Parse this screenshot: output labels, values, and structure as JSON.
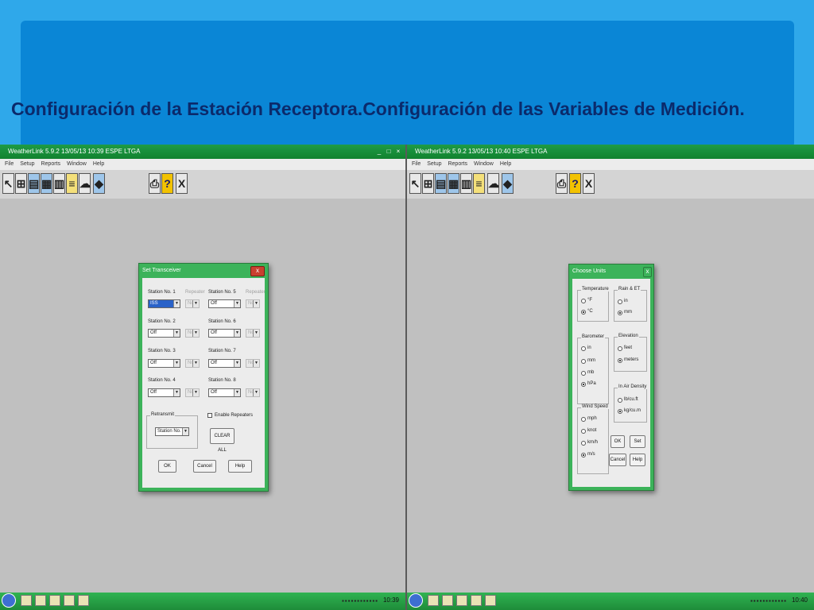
{
  "slide": {
    "title": "Configuración de la Estación Receptora.Configuración de las Variables de Medición."
  },
  "windows": {
    "left": {
      "title": "WeatherLink 5.9.2  13/05/13  10:39  ESPE LTGA",
      "clock": "10:39",
      "menu": [
        "File",
        "Setup",
        "Reports",
        "Window",
        "Help"
      ]
    },
    "right": {
      "title": "WeatherLink 5.9.2  13/05/13  10:40  ESPE LTGA",
      "clock": "10:40",
      "menu": [
        "File",
        "Setup",
        "Reports",
        "Window",
        "Help"
      ]
    }
  },
  "toolbar": {
    "quit_label": "X",
    "help_label": "?"
  },
  "set_transceiver": {
    "title": "Set Transceiver",
    "close": "x",
    "repeater_label": "Repeater",
    "stations": [
      {
        "label": "Station No. 1",
        "value": "ISS",
        "repeater": "No"
      },
      {
        "label": "Station No. 2",
        "value": "Off",
        "repeater": "No"
      },
      {
        "label": "Station No. 3",
        "value": "Off",
        "repeater": "No"
      },
      {
        "label": "Station No. 4",
        "value": "Off",
        "repeater": "No"
      },
      {
        "label": "Station No. 5",
        "value": "Off",
        "repeater": "No"
      },
      {
        "label": "Station No. 6",
        "value": "Off",
        "repeater": "No"
      },
      {
        "label": "Station No. 7",
        "value": "Off",
        "repeater": "No"
      },
      {
        "label": "Station No. 8",
        "value": "Off",
        "repeater": "No"
      }
    ],
    "retransmit_label": "Retransmit",
    "retransmit_value": "Station No. 2",
    "enable_repeaters": "Enable Repeaters",
    "clear_all": "CLEAR ALL",
    "ok": "OK",
    "cancel": "Cancel",
    "help": "Help"
  },
  "choose_units": {
    "title": "Choose Units",
    "close": "x",
    "temperature": {
      "label": "Temperature",
      "options": [
        "°F",
        "°C"
      ],
      "selected": "°C"
    },
    "barometer": {
      "label": "Barometer",
      "options": [
        "in",
        "mm",
        "mb",
        "hPa"
      ],
      "selected": "hPa"
    },
    "wind_speed": {
      "label": "Wind Speed",
      "options": [
        "mph",
        "knot",
        "km/h",
        "m/s"
      ],
      "selected": "m/s"
    },
    "rain_et": {
      "label": "Rain & ET",
      "options": [
        "in",
        "mm"
      ],
      "selected": "mm"
    },
    "elevation": {
      "label": "Elevation",
      "options": [
        "feet",
        "meters"
      ],
      "selected": "meters"
    },
    "air_density": {
      "label": "In Air Density",
      "options": [
        "lb/cu.ft",
        "kg/cu.m"
      ],
      "selected": "kg/cu.m"
    },
    "ok": "OK",
    "set": "Set",
    "cancel": "Cancel",
    "help": "Help"
  }
}
